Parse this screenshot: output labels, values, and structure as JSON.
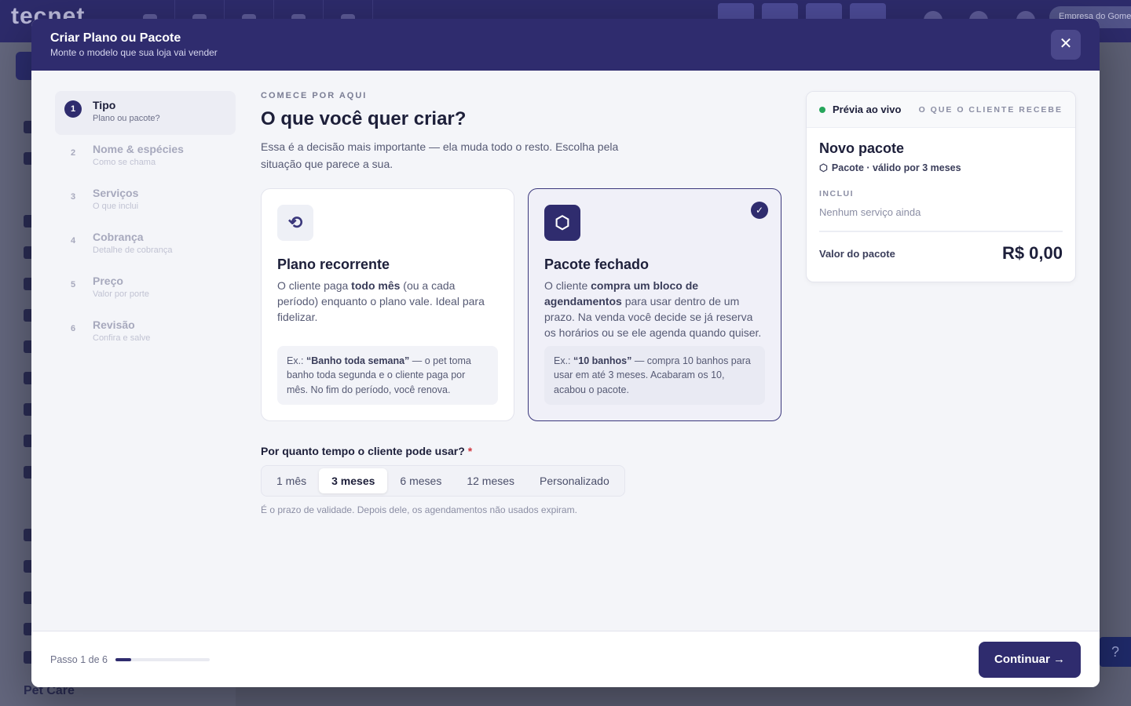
{
  "background": {
    "logo": "tecnet",
    "company": "Empresa do Gomes",
    "sidebar_brand": "Pet Care",
    "help_icon": "question-icon"
  },
  "modal": {
    "title": "Criar Plano ou Pacote",
    "subtitle": "Monte o modelo que sua loja vai vender",
    "close_icon": "close-icon",
    "close_glyph": "✕"
  },
  "steps": [
    {
      "num": "1",
      "label": "Tipo",
      "sub": "Plano ou pacote?",
      "active": true
    },
    {
      "num": "2",
      "label": "Nome & espécies",
      "sub": "Como se chama",
      "active": false
    },
    {
      "num": "3",
      "label": "Serviços",
      "sub": "O que inclui",
      "active": false
    },
    {
      "num": "4",
      "label": "Cobrança",
      "sub": "Detalhe de cobrança",
      "active": false
    },
    {
      "num": "5",
      "label": "Preço",
      "sub": "Valor por porte",
      "active": false
    },
    {
      "num": "6",
      "label": "Revisão",
      "sub": "Confira e salve",
      "active": false
    }
  ],
  "main": {
    "eyebrow": "COMECE POR AQUI",
    "title": "O que você quer criar?",
    "description": "Essa é a decisão mais importante — ela muda todo o resto. Escolha pela situação que parece a sua."
  },
  "options": {
    "recurring": {
      "icon": "refresh-icon",
      "glyph": "⟲",
      "title": "Plano recorrente",
      "desc_1": "O cliente paga ",
      "desc_bold": "todo mês",
      "desc_2": " (ou a cada período) enquanto o plano vale. Ideal para fidelizar.",
      "ex_prefix": "Ex.: ",
      "ex_bold": "“Banho toda semana”",
      "ex_rest": " — o pet toma banho toda segunda e o cliente paga por mês. No fim do período, você renova.",
      "selected": false
    },
    "package": {
      "icon": "box-icon",
      "glyph": "⬡",
      "title": "Pacote fechado",
      "desc_1": "O cliente ",
      "desc_bold": "compra um bloco de agendamentos",
      "desc_2": " para usar dentro de um prazo. Na venda você decide se já reserva os horários ou se ele agenda quando quiser.",
      "ex_prefix": "Ex.: ",
      "ex_bold": "“10 banhos”",
      "ex_rest": " — compra 10 banhos para usar em até 3 meses. Acabaram os 10, acabou o pacote.",
      "selected": true,
      "check_glyph": "✓"
    }
  },
  "duration": {
    "label": "Por quanto tempo o cliente pode usar?",
    "required_mark": "*",
    "options": [
      "1 mês",
      "3 meses",
      "6 meses",
      "12 meses",
      "Personalizado"
    ],
    "selected": "3 meses",
    "hint": "É o prazo de validade. Depois dele, os agendamentos não usados expiram."
  },
  "preview": {
    "live_label": "Prévia ao vivo",
    "tag": "O QUE O CLIENTE RECEBE",
    "name": "Novo pacote",
    "meta_icon": "box-icon",
    "meta_glyph": "⬡",
    "meta": "Pacote · válido por 3 meses",
    "includes_label": "INCLUI",
    "includes_empty": "Nenhum serviço ainda",
    "total_label": "Valor do pacote",
    "total_value": "R$ 0,00",
    "live_color": "#26a65b"
  },
  "footer": {
    "step_text": "Passo 1 de 6",
    "progress_fraction": 0.167,
    "continue_label": "Continuar →"
  },
  "colors": {
    "brand": "#2f2c6e",
    "required": "#d0363f"
  }
}
